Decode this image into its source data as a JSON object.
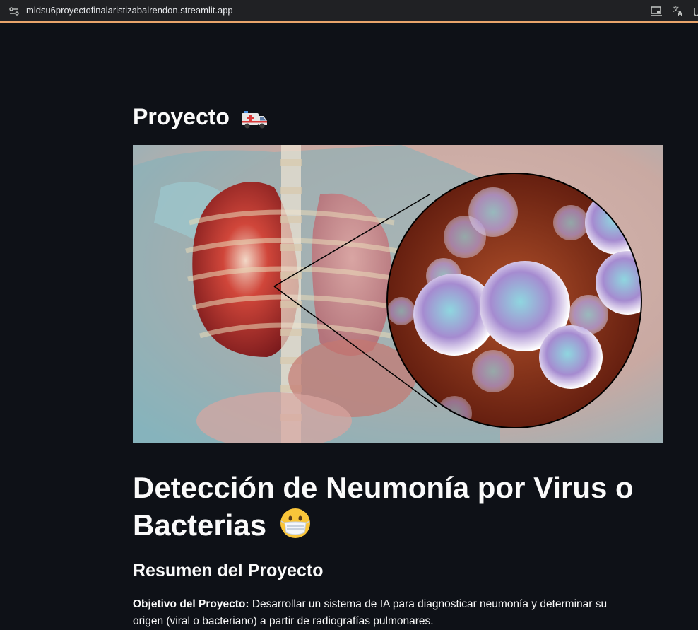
{
  "browser": {
    "url": "mldsu6proyectofinalaristizabalrendon.streamlit.app",
    "icons": [
      "site-info-icon",
      "cast-icon",
      "translate-icon"
    ]
  },
  "page": {
    "section_title": "Proyecto",
    "section_title_icon": "ambulance-icon",
    "hero_image_icon": "pneumonia-lungs-bacteria-image",
    "main_heading": "Detección de Neumonía por Virus o Bacterias",
    "main_heading_icon": "face-mask-icon",
    "subheading": "Resumen del Proyecto",
    "objective_label": "Objetivo del Proyecto:",
    "objective_text": "Desarrollar un sistema de IA para diagnosticar neumonía y determinar su origen (viral o bacteriano) a partir de radiografías pulmonares."
  },
  "colors": {
    "background": "#0e1117",
    "text": "#fafafa",
    "browser_bar": "#202124",
    "accent_line": "#e8a46b"
  }
}
